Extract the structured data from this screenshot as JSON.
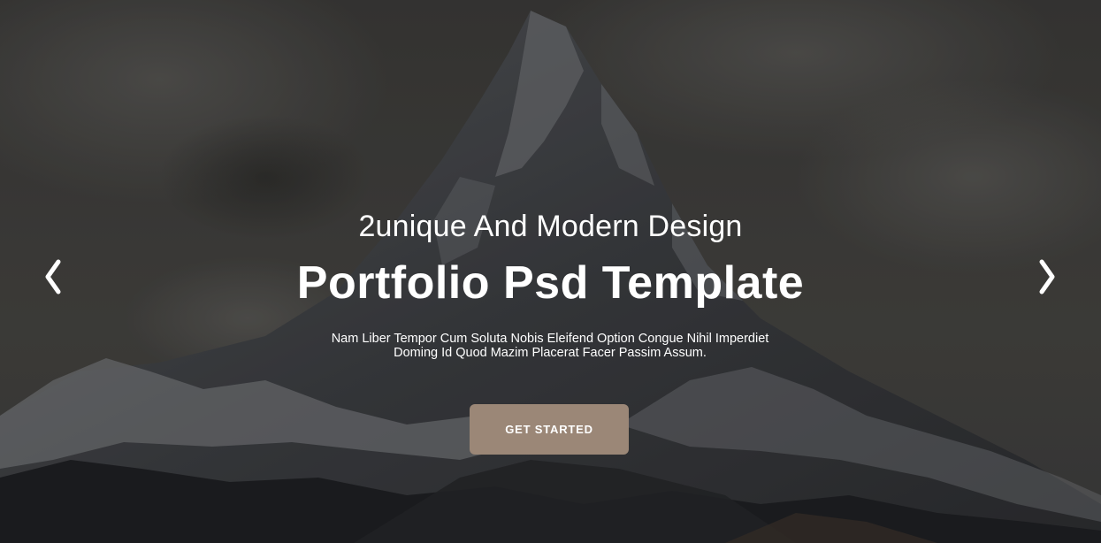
{
  "hero": {
    "subtitle": "2unique And Modern Design",
    "title": "Portfolio Psd Template",
    "description_line1": "Nam Liber Tempor Cum Soluta Nobis Eleifend Option Congue Nihil Imperdiet",
    "description_line2": "Doming Id Quod Mazim Placerat Facer Passim Assum.",
    "cta_label": "GET STARTED",
    "background": "mountain-peak-image"
  },
  "slider": {
    "prev_icon": "chevron-left-icon",
    "next_icon": "chevron-right-icon"
  },
  "colors": {
    "text": "#ffffff",
    "button": "#9b8777",
    "sky": "#3b3a38",
    "mountain_dark": "#1f2022",
    "snow": "#8d8f93"
  }
}
